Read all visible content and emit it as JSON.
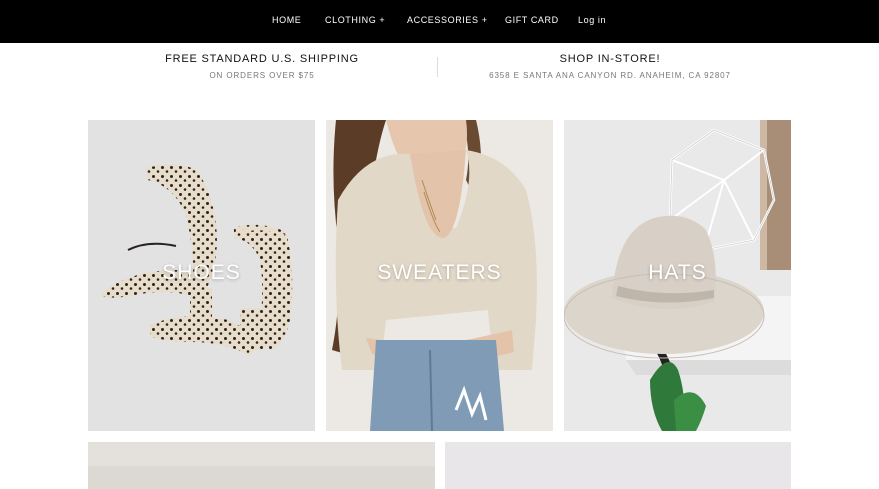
{
  "nav": {
    "items": [
      "HOME",
      "CLOTHING +",
      "ACCESSORIES +",
      "GIFT CARD",
      "Log in"
    ]
  },
  "info_bar": {
    "shipping_title": "FREE STANDARD U.S. SHIPPING",
    "shipping_sub": "ON ORDERS OVER $75",
    "store_title": "SHOP IN-STORE!",
    "store_sub": "6358 E SANTA ANA CANYON RD. ANAHEIM, CA 92807"
  },
  "categories": [
    "SHOES",
    "SWEATERS",
    "HATS"
  ]
}
